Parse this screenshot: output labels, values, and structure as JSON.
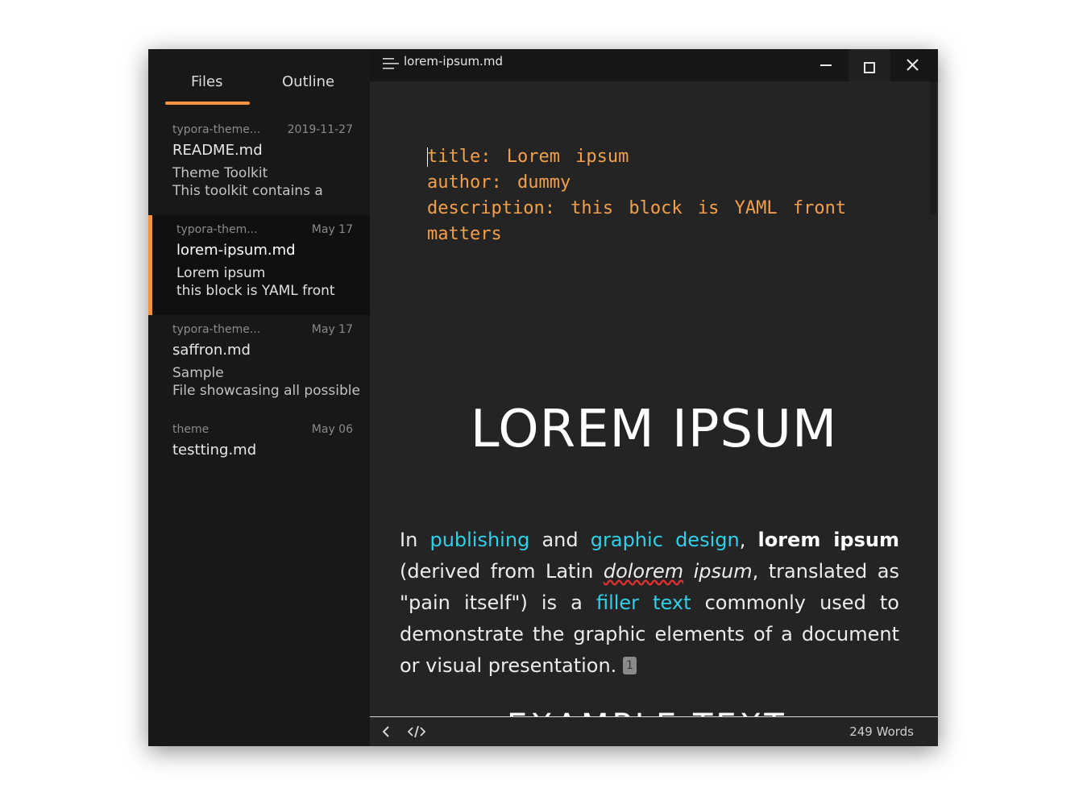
{
  "window": {
    "title": "lorem-ipsum.md",
    "controls": {
      "minimize": "minimize",
      "maximize": "maximize",
      "close": "close"
    }
  },
  "sidebar": {
    "tabs": [
      {
        "label": "Files",
        "active": true
      },
      {
        "label": "Outline",
        "active": false
      }
    ],
    "files": [
      {
        "folder": "typora-theme...",
        "date": "2019-11-27",
        "name": "README.md",
        "line1": "Theme Toolkit",
        "line2": "This toolkit contains a",
        "active": false
      },
      {
        "folder": "typora-them...",
        "date": "May 17",
        "name": "lorem-ipsum.md",
        "line1": "Lorem ipsum",
        "line2": "this block is YAML front",
        "active": true
      },
      {
        "folder": "typora-theme...",
        "date": "May 17",
        "name": "saffron.md",
        "line1": "Sample",
        "line2": "File showcasing all possible",
        "active": false
      },
      {
        "folder": "theme",
        "date": "May 06",
        "name": "testting.md",
        "line1": "",
        "line2": "",
        "active": false
      }
    ]
  },
  "editor": {
    "yaml": "title: Lorem ipsum\nauthor: dummy\ndescription: this block is YAML front matters",
    "heading": "LOREM IPSUM",
    "paragraph": {
      "t1": "In ",
      "link1": "publishing",
      "t2": " and ",
      "link2": "graphic",
      "t3": " ",
      "link3": "design",
      "t4": ", ",
      "bold1": "lorem ipsum",
      "t5": " (derived from Latin ",
      "em1": "dolorem",
      "t6": " ",
      "em2": "ipsum",
      "t7": ", translated as \"pain itself\") is a ",
      "link4": "filler",
      "t8": " ",
      "link5": "text",
      "t9": " commonly used to demonstrate the graphic elements of a document or visual presentation. ",
      "footnote": "1"
    },
    "next_heading": "EXAMPLE TEXT"
  },
  "statusbar": {
    "word_count": "249 Words"
  },
  "colors": {
    "accent": "#f79443",
    "link": "#2fd0e8",
    "yaml": "#f2a04a"
  }
}
